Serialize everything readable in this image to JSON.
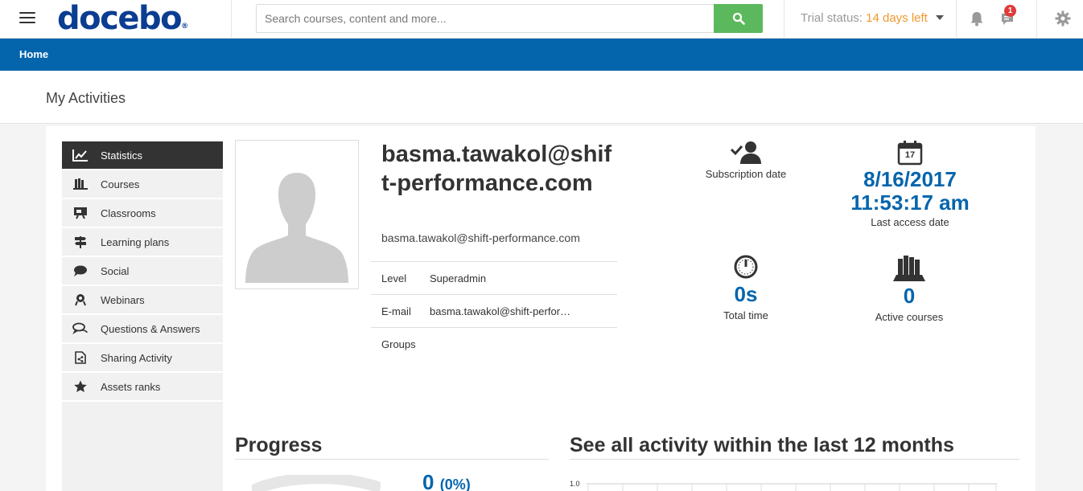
{
  "header": {
    "logo_text": "docebo",
    "logo_mark": "®",
    "search_placeholder": "Search courses, content and more...",
    "trial_prefix": "Trial status: ",
    "trial_days": "14 days left",
    "notification_count": "1"
  },
  "navbar": {
    "home_label": "Home"
  },
  "page": {
    "title": "My Activities"
  },
  "sidebar": {
    "items": [
      {
        "label": "Statistics",
        "icon": "chart-icon",
        "active": true
      },
      {
        "label": "Courses",
        "icon": "courses-icon"
      },
      {
        "label": "Classrooms",
        "icon": "classroom-icon"
      },
      {
        "label": "Learning plans",
        "icon": "signpost-icon"
      },
      {
        "label": "Social",
        "icon": "chat-icon"
      },
      {
        "label": "Webinars",
        "icon": "webinar-icon"
      },
      {
        "label": "Questions & Answers",
        "icon": "qa-icon"
      },
      {
        "label": "Sharing Activity",
        "icon": "share-icon"
      },
      {
        "label": "Assets ranks",
        "icon": "star-icon"
      }
    ]
  },
  "profile": {
    "fullname": "basma.tawakol@shift-performance.com",
    "email": "basma.tawakol@shift-performance.com",
    "fields": [
      {
        "key": "Level",
        "value": "Superadmin"
      },
      {
        "key": "E-mail",
        "value": "basma.tawakol@shift-performance.com"
      },
      {
        "key": "Groups",
        "value": ""
      }
    ]
  },
  "stats": {
    "subscription_label": "Subscription date",
    "last_access_date": "8/16/2017",
    "last_access_time": "11:53:17 am",
    "last_access_label": "Last access date",
    "calendar_day": "17",
    "total_time": "0s",
    "total_time_label": "Total time",
    "active_courses": "0",
    "active_courses_label": "Active courses"
  },
  "progress": {
    "title": "Progress",
    "value": "0",
    "percent": "(0%)"
  },
  "activity": {
    "title": "See all activity within the last 12 months",
    "y_tick_top": "1.0"
  },
  "colors": {
    "brand_blue": "#0465ac",
    "logo_blue": "#0b3d91",
    "search_green": "#5cb85c",
    "trial_orange": "#f0982c",
    "badge_red": "#e03a3a"
  }
}
